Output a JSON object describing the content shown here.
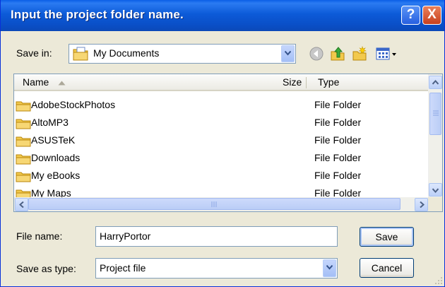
{
  "dialog": {
    "title": "Input the project folder name.",
    "help_glyph": "?",
    "close_glyph": "X"
  },
  "toolbar": {
    "save_in_label": "Save in:",
    "location": "My Documents",
    "icons": [
      "back-icon",
      "up-folder-icon",
      "new-folder-icon",
      "views-menu-icon"
    ]
  },
  "file_list": {
    "columns": {
      "name": "Name",
      "size": "Size",
      "type": "Type"
    },
    "rows": [
      {
        "name": "AdobeStockPhotos",
        "type": "File Folder"
      },
      {
        "name": "AltoMP3",
        "type": "File Folder"
      },
      {
        "name": "ASUSTeK",
        "type": "File Folder"
      },
      {
        "name": "Downloads",
        "type": "File Folder"
      },
      {
        "name": "My eBooks",
        "type": "File Folder"
      },
      {
        "name": "My Maps",
        "type": "File Folder"
      }
    ]
  },
  "form": {
    "file_name_label": "File name:",
    "file_name_value": "HarryPortor",
    "save_as_type_label": "Save as type:",
    "save_as_type_value": "Project file"
  },
  "buttons": {
    "save": "Save",
    "cancel": "Cancel"
  },
  "colors": {
    "title_bar": "#0a4fc7",
    "dialog_bg": "#ece9d8",
    "close_button": "#c8401e",
    "folder": "#f2c94c"
  }
}
